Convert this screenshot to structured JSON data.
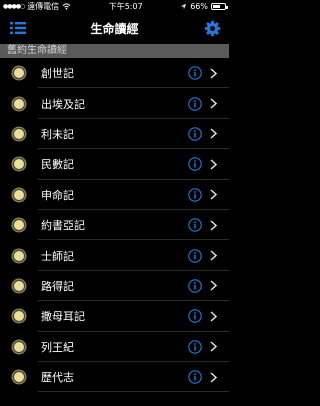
{
  "status_bar": {
    "carrier": "遠傳電信",
    "time": "下午5:07",
    "battery": "66%",
    "battery_level": 0.66
  },
  "nav": {
    "title": "生命讀經",
    "menu_icon": "list-icon",
    "settings_icon": "gear-icon"
  },
  "section": {
    "header": "舊約生命讀經"
  },
  "books": [
    {
      "label": "創世記"
    },
    {
      "label": "出埃及記"
    },
    {
      "label": "利未記"
    },
    {
      "label": "民數記"
    },
    {
      "label": "申命記"
    },
    {
      "label": "約書亞記"
    },
    {
      "label": "士師記"
    },
    {
      "label": "路得記"
    },
    {
      "label": "撒母耳記"
    },
    {
      "label": "列王紀"
    },
    {
      "label": "歷代志"
    }
  ],
  "colors": {
    "accent": "#1e7be0",
    "disc_fill": "#e8df9e",
    "disc_ring": "#8a8258",
    "section_bg": "#5a5a5a"
  }
}
